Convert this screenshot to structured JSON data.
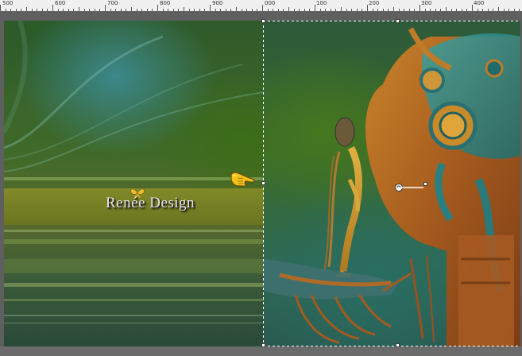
{
  "ruler": {
    "labels": [
      "500",
      "600",
      "700",
      "800",
      "900",
      "000",
      "100",
      "200",
      "300",
      "400"
    ]
  },
  "canvas": {
    "watermark_text": "Renée Design"
  },
  "colors": {
    "ruler_bg": "#f0f0f0",
    "workspace_bg": "#5f5f5f",
    "selection_marquee": "#ffffff",
    "logo_text": "#e8e8e8"
  },
  "icons": {
    "cursor": "pointing-hand-icon",
    "logo": "butterfly-icon",
    "rotate": "rotation-handle-icon"
  }
}
